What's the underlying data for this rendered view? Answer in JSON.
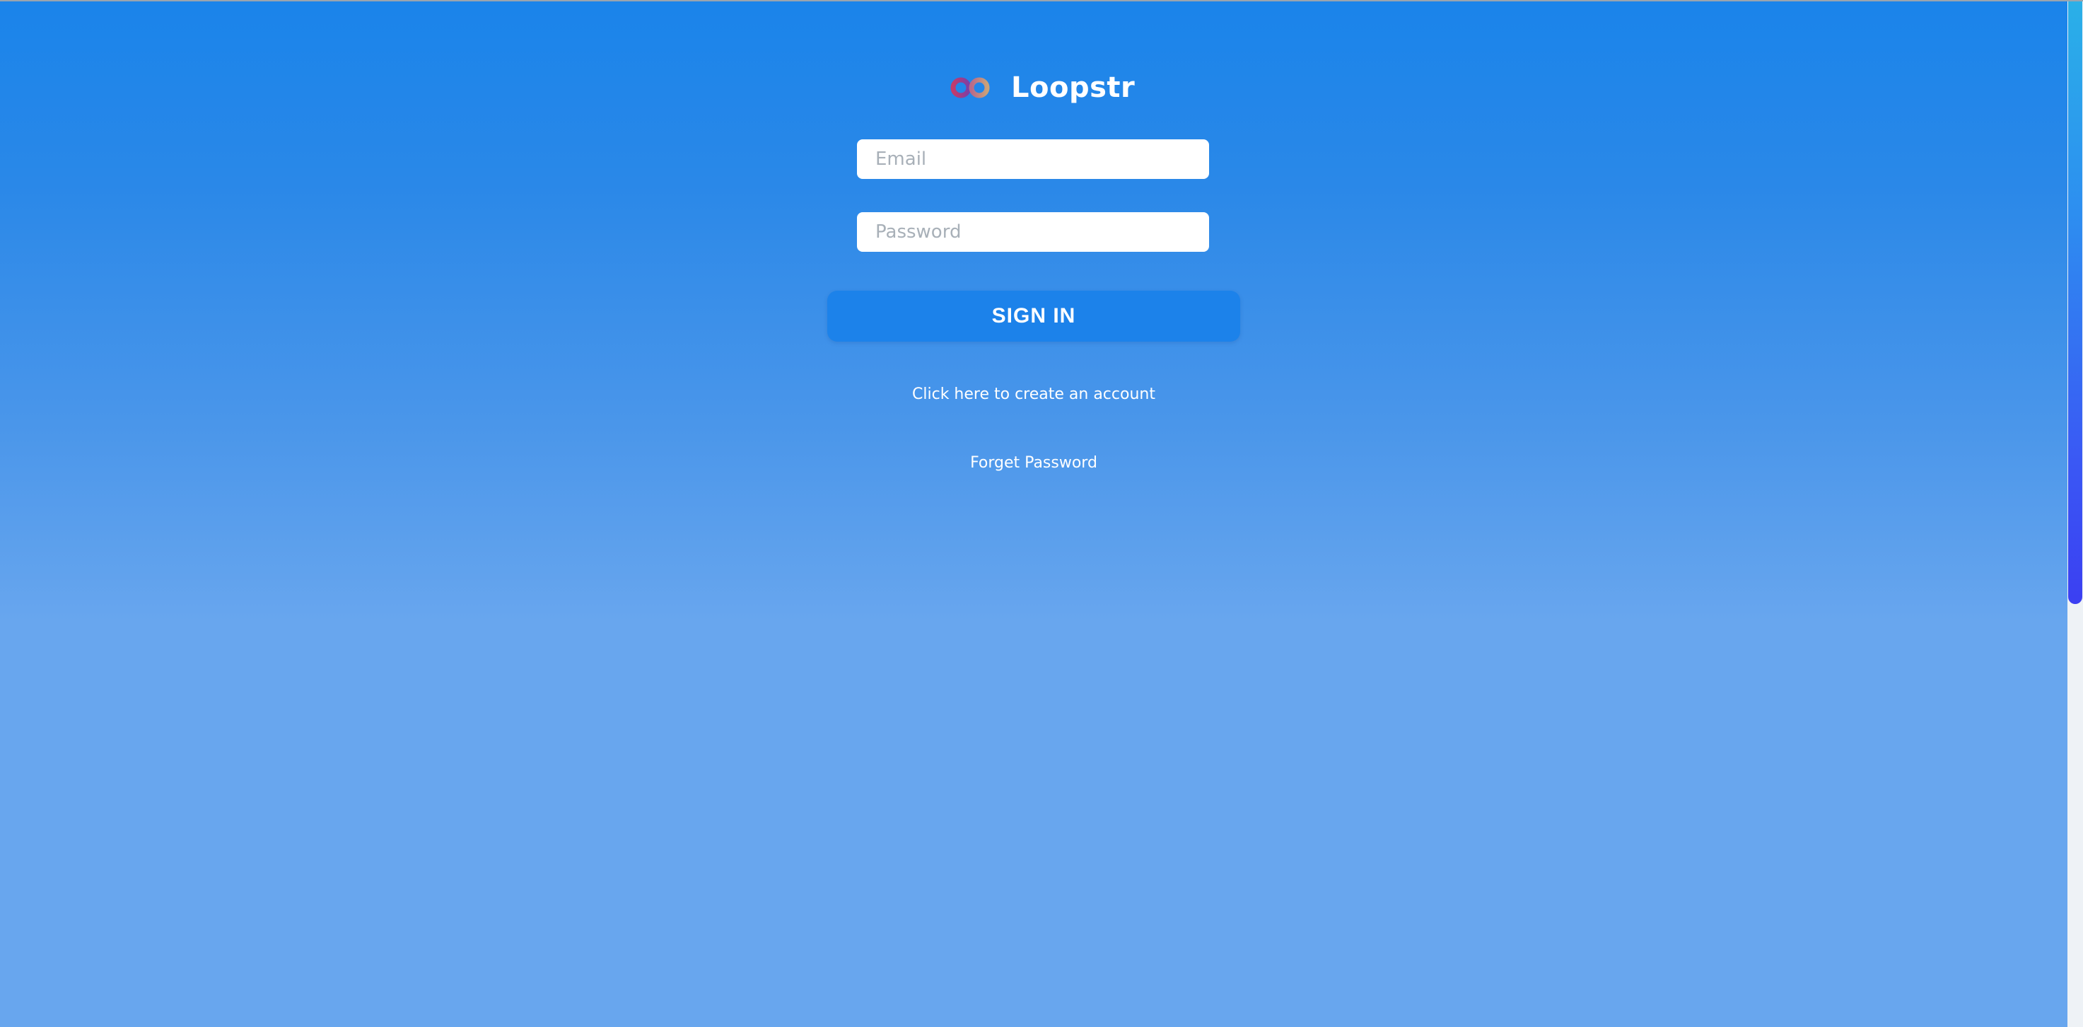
{
  "brand": {
    "name": "Loopstr",
    "logo_icon": "infinity-logo-icon"
  },
  "form": {
    "email_placeholder": "Email",
    "email_value": "",
    "password_placeholder": "Password",
    "password_value": "",
    "signin_label": "SIGN IN",
    "create_account_label": "Click here to create an account",
    "forgot_password_label": "Forget Password"
  },
  "colors": {
    "background_top": "#1a84ea",
    "background_bottom": "#68a6ee",
    "button": "#1c82ea",
    "text": "#ffffff"
  }
}
